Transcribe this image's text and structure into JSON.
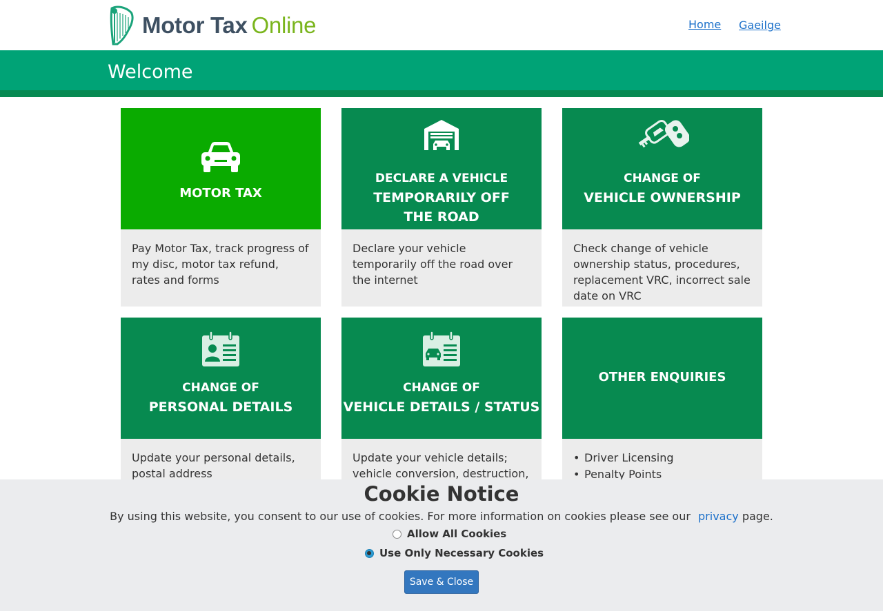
{
  "header": {
    "logo_primary": "Motor Tax",
    "logo_secondary": "Online",
    "nav": {
      "home": "Home",
      "gaeilge": "Gaeilge"
    }
  },
  "banner": {
    "title": "Welcome"
  },
  "cards": [
    {
      "icon": "car-icon",
      "title_line1": "MOTOR TAX",
      "title_line2": "",
      "description": "Pay Motor Tax, track progress of my disc, motor tax refund, rates and forms"
    },
    {
      "icon": "garage-icon",
      "title_line1": "DECLARE A VEHICLE",
      "title_line2": "TEMPORARILY OFF THE ROAD",
      "description": "Declare your vehicle temporarily off the road over the internet"
    },
    {
      "icon": "car-keys-icon",
      "title_line1": "CHANGE OF",
      "title_line2": "VEHICLE OWNERSHIP",
      "description": "Check change of vehicle ownership status, procedures, replacement VRC, incorrect sale date on VRC"
    },
    {
      "icon": "personal-details-icon",
      "title_line1": "CHANGE OF",
      "title_line2": "PERSONAL DETAILS",
      "description": "Update your personal details, postal address"
    },
    {
      "icon": "vehicle-details-icon",
      "title_line1": "CHANGE OF",
      "title_line2": "VEHICLE DETAILS / STATUS",
      "description": "Update your vehicle details; vehicle conversion, destruction,"
    },
    {
      "icon": "",
      "title_line1": "OTHER ENQUIRIES",
      "title_line2": "",
      "bullets": [
        "Driver Licensing",
        "Penalty Points"
      ]
    }
  ],
  "cookie": {
    "title": "Cookie Notice",
    "text_before": "By using this website, you consent to our use of cookies. For more information on cookies please see our",
    "link": "privacy",
    "text_after": " page.",
    "options": [
      {
        "label": "Allow All Cookies",
        "checked": false
      },
      {
        "label": "Use Only Necessary Cookies",
        "checked": true
      }
    ],
    "button": "Save & Close"
  },
  "colors": {
    "brand_green": "#078a50",
    "bright_green": "#0aab00",
    "banner_green": "#00a376",
    "link_blue": "#1a6fc9",
    "button_blue": "#3377bf"
  }
}
